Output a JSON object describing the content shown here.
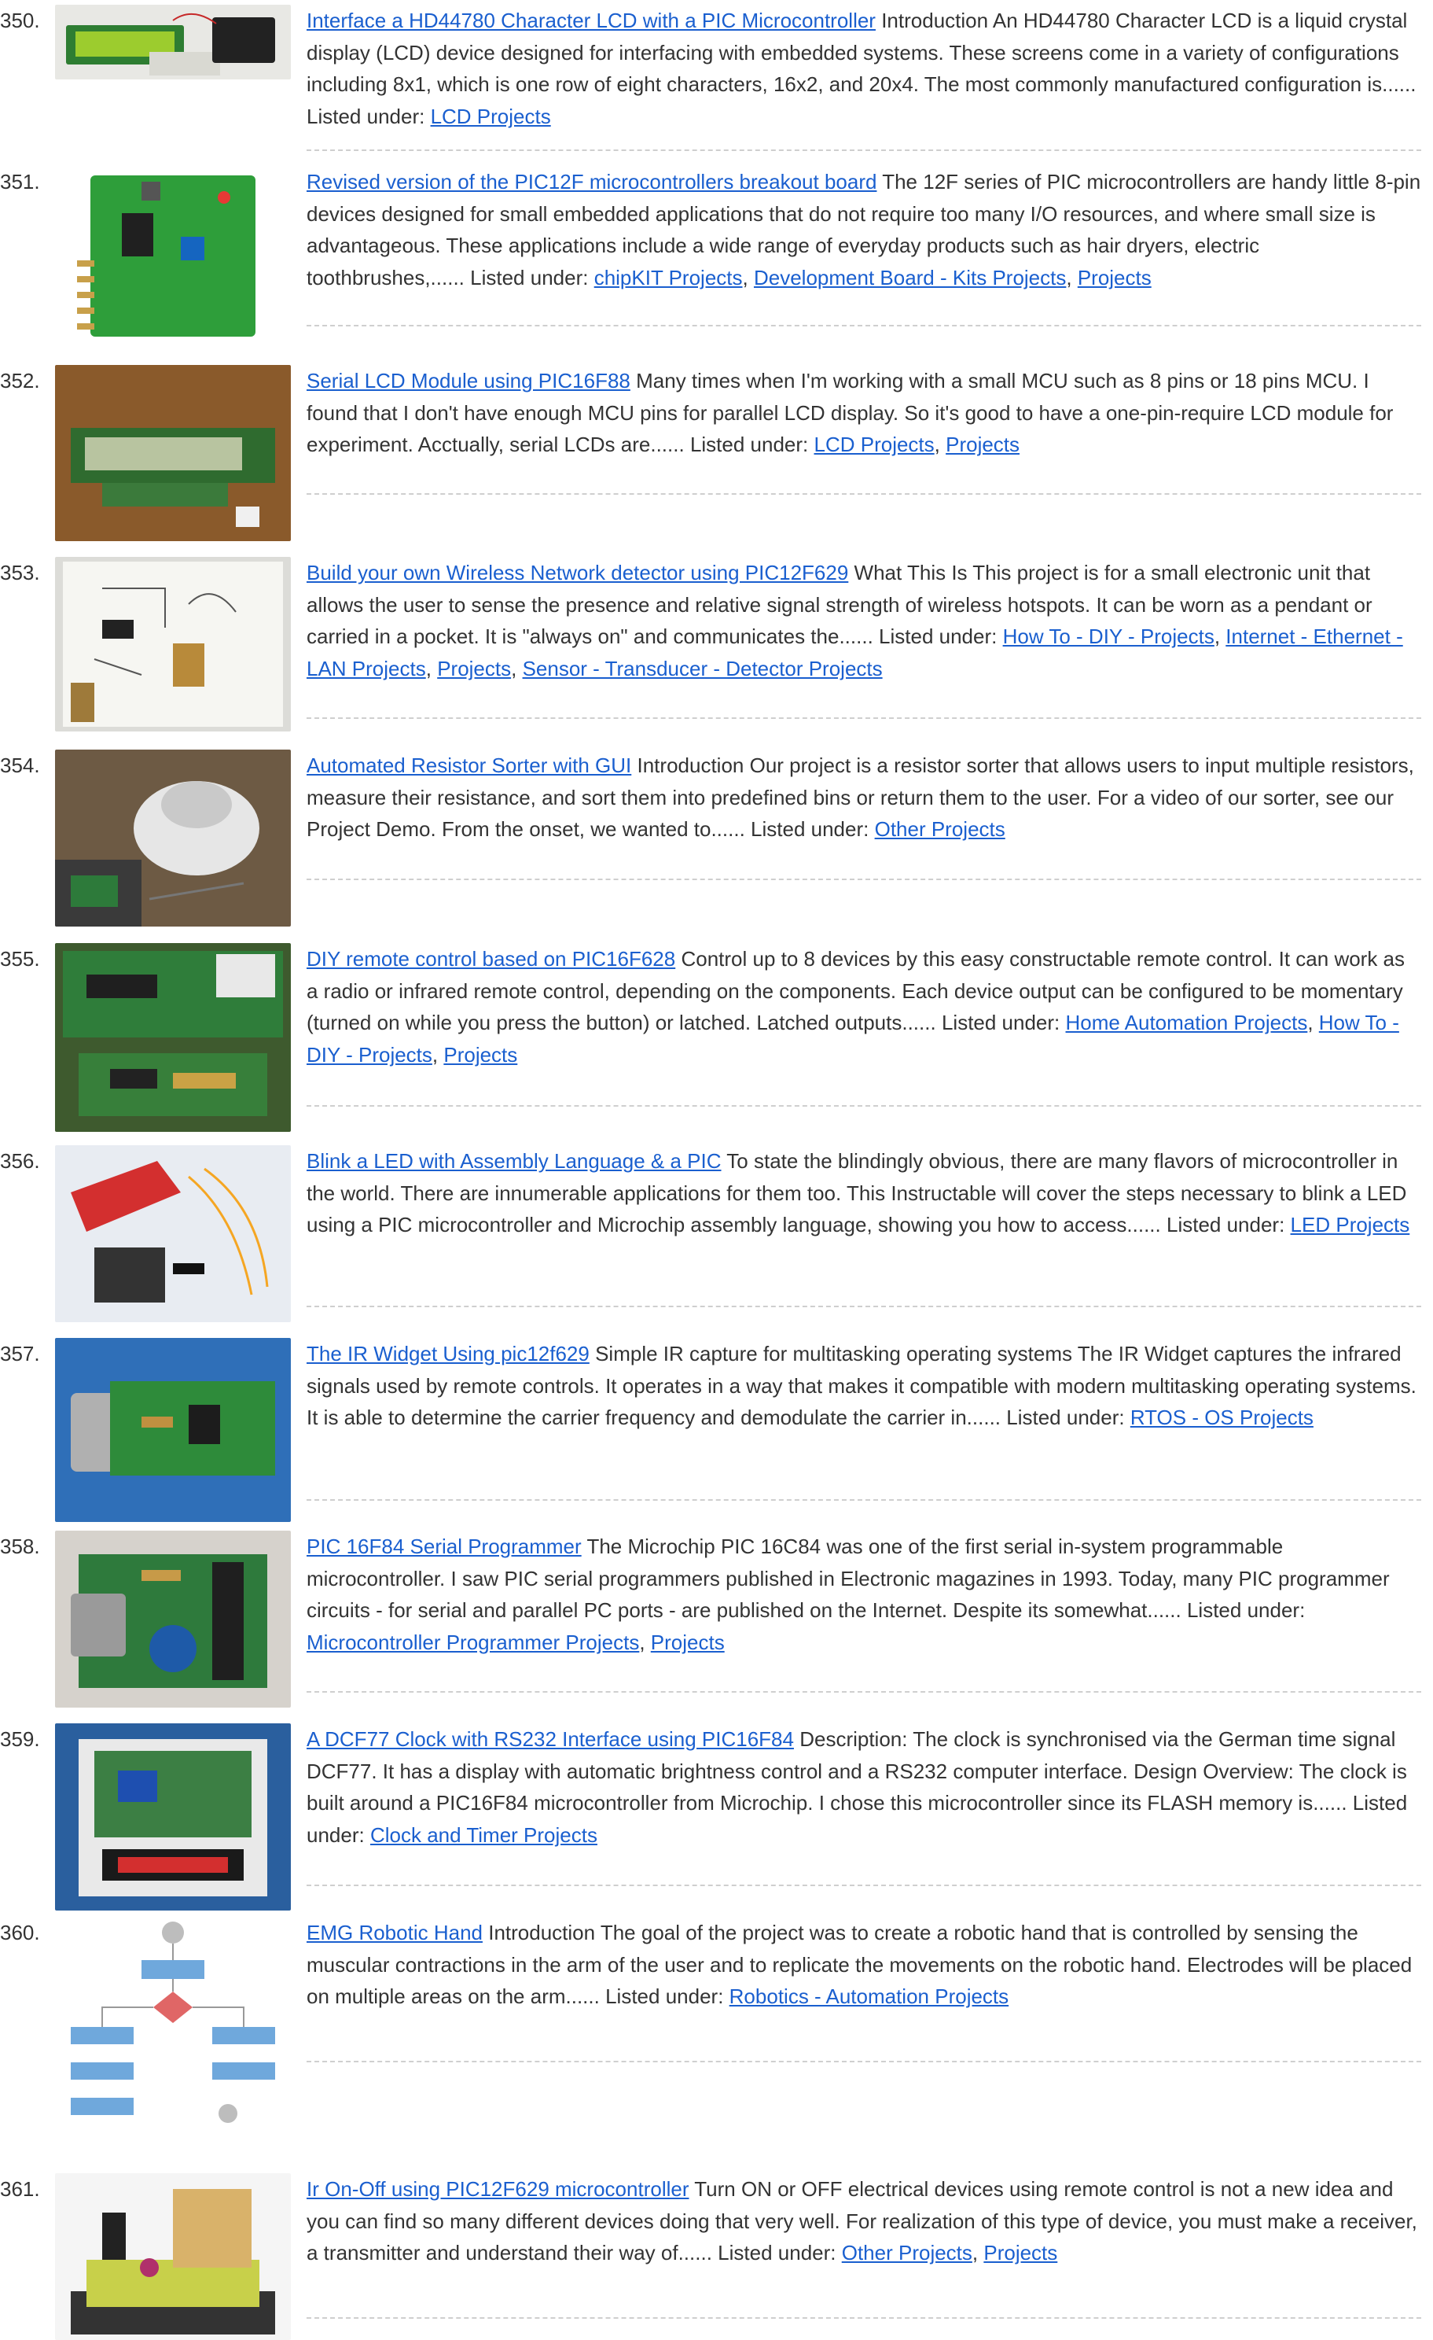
{
  "entries": [
    {
      "num": "350.",
      "title": "Interface a HD44780 Character LCD with a PIC Microcontroller",
      "desc": "Introduction An HD44780 Character LCD is a liquid crystal display (LCD) device designed for interfacing with embedded systems. These screens come in a variety of configurations including 8x1, which is one row of eight characters, 16x2, and 20x4. The most commonly manufactured configuration is......",
      "listed_under": "Listed under:",
      "categories": [
        "LCD Projects"
      ],
      "thumb_icon": "lcd-breadboard-photo"
    },
    {
      "num": "351.",
      "title": "Revised version of the PIC12F microcontrollers breakout board",
      "desc": "The 12F series of PIC microcontrollers are handy little 8-pin devices designed for small embedded applications that do not require too many I/O resources, and where small size is advantageous. These applications include a wide range of everyday products such as hair dryers, electric toothbrushes,......",
      "listed_under": "Listed under:",
      "categories": [
        "chipKIT Projects",
        "Development Board - Kits Projects",
        "Projects"
      ],
      "thumb_icon": "breakout-board-photo"
    },
    {
      "num": "352.",
      "title": "Serial LCD Module using PIC16F88",
      "desc": "Many times when I'm working with a small MCU such as 8 pins or 18 pins MCU. I found that I don't have enough MCU pins for parallel LCD display. So it's good to have a one-pin-require LCD module for experiment. Acctually, serial LCDs are......",
      "listed_under": "Listed under:",
      "categories": [
        "LCD Projects",
        "Projects"
      ],
      "thumb_icon": "serial-lcd-photo"
    },
    {
      "num": "353.",
      "title": "Build your own Wireless Network detector using PIC12F629",
      "desc": "What This Is This project is for a small electronic unit that allows the user to sense the presence and relative signal strength of wireless hotspots. It can be worn as a pendant or carried in a pocket. It is \"always on\" and communicates the......",
      "listed_under": "Listed under:",
      "categories": [
        "How To - DIY - Projects",
        "Internet - Ethernet - LAN Projects",
        "Projects",
        "Sensor - Transducer - Detector Projects"
      ],
      "thumb_icon": "sketch-paper-photo"
    },
    {
      "num": "354.",
      "title": "Automated Resistor Sorter with GUI",
      "desc": "Introduction Our project is a resistor sorter that allows users to input multiple resistors, measure their resistance, and sort them into predefined bins or return them to the user. For a video of our sorter, see our Project Demo. From the onset, we wanted to......",
      "listed_under": "Listed under:",
      "categories": [
        "Other Projects"
      ],
      "thumb_icon": "resistor-sorter-photo"
    },
    {
      "num": "355.",
      "title": "DIY remote control based on PIC16F628",
      "desc": "Control up to 8 devices by this easy constructable remote control. It can work as a radio or infrared remote control, depending on the components. Each device output can be configured to be momentary (turned on while you press the button) or latched. Latched outputs......",
      "listed_under": "Listed under:",
      "categories": [
        "Home Automation Projects",
        "How To - DIY - Projects",
        "Projects"
      ],
      "thumb_icon": "rf-module-photo"
    },
    {
      "num": "356.",
      "title": "Blink a LED with Assembly Language & a PIC",
      "desc": "To state the blindingly obvious, there are many flavors of microcontroller in the world.  There are innumerable applications for them too.  This Instructable will cover the steps necessary to blink a LED using a PIC microcontroller and Microchip assembly language, showing you how to access......",
      "listed_under": "Listed under:",
      "categories": [
        "LED Projects"
      ],
      "thumb_icon": "pickit-photo"
    },
    {
      "num": "357.",
      "title": "The IR Widget Using pic12f629",
      "desc": "Simple IR capture for multitasking operating systems The IR Widget captures the infrared signals used by remote controls. It operates in a way that makes it compatible with modern multitasking operating systems. It is able to determine the carrier frequency and demodulate the carrier in......",
      "listed_under": "Listed under:",
      "categories": [
        "RTOS - OS Projects"
      ],
      "thumb_icon": "ir-widget-photo"
    },
    {
      "num": "358.",
      "title": "PIC 16F84 Serial Programmer",
      "desc": "The Microchip PIC 16C84 was one of the first serial in-system programmable microcontroller. I saw PIC serial programmers published in Electronic magazines in 1993. Today, many PIC programmer circuits - for serial and parallel PC ports - are published on the Internet. Despite its somewhat......",
      "listed_under": "Listed under:",
      "categories": [
        "Microcontroller Programmer Projects",
        "Projects"
      ],
      "thumb_icon": "serial-programmer-photo"
    },
    {
      "num": "359.",
      "title": "A DCF77 Clock with RS232 Interface using PIC16F84",
      "desc": "Description: The clock is synchronised via the German time signal DCF77. It has a display with automatic brightness control and a RS232 computer interface. Design Overview: The clock is built around a PIC16F84 microcontroller from Microchip. I chose this microcontroller since its FLASH memory is......",
      "listed_under": "Listed under:",
      "categories": [
        "Clock and Timer Projects"
      ],
      "thumb_icon": "dcf77-clock-photo"
    },
    {
      "num": "360.",
      "title": "EMG Robotic Hand",
      "desc": "Introduction The goal of the project was to create a robotic hand that is controlled by sensing the muscular contractions in the arm of the user and to replicate the movements on the robotic hand. Electrodes will be placed on multiple areas on the arm......",
      "listed_under": "Listed under:",
      "categories": [
        "Robotics - Automation Projects"
      ],
      "thumb_icon": "flowchart-photo"
    },
    {
      "num": "361.",
      "title": "Ir On-Off using PIC12F629 microcontroller",
      "desc": "Turn ON or OFF electrical devices using remote control is not a new idea and you can find so many different devices doing that very well. For realization of this type of device, you must make a receiver, a transmitter and understand their way of......",
      "listed_under": "Listed under:",
      "categories": [
        "Other Projects",
        "Projects"
      ],
      "thumb_icon": "ir-relay-photo"
    }
  ],
  "colors": {
    "link": "#1a5fcf",
    "text": "#333333",
    "separator": "#cfcfcf"
  }
}
